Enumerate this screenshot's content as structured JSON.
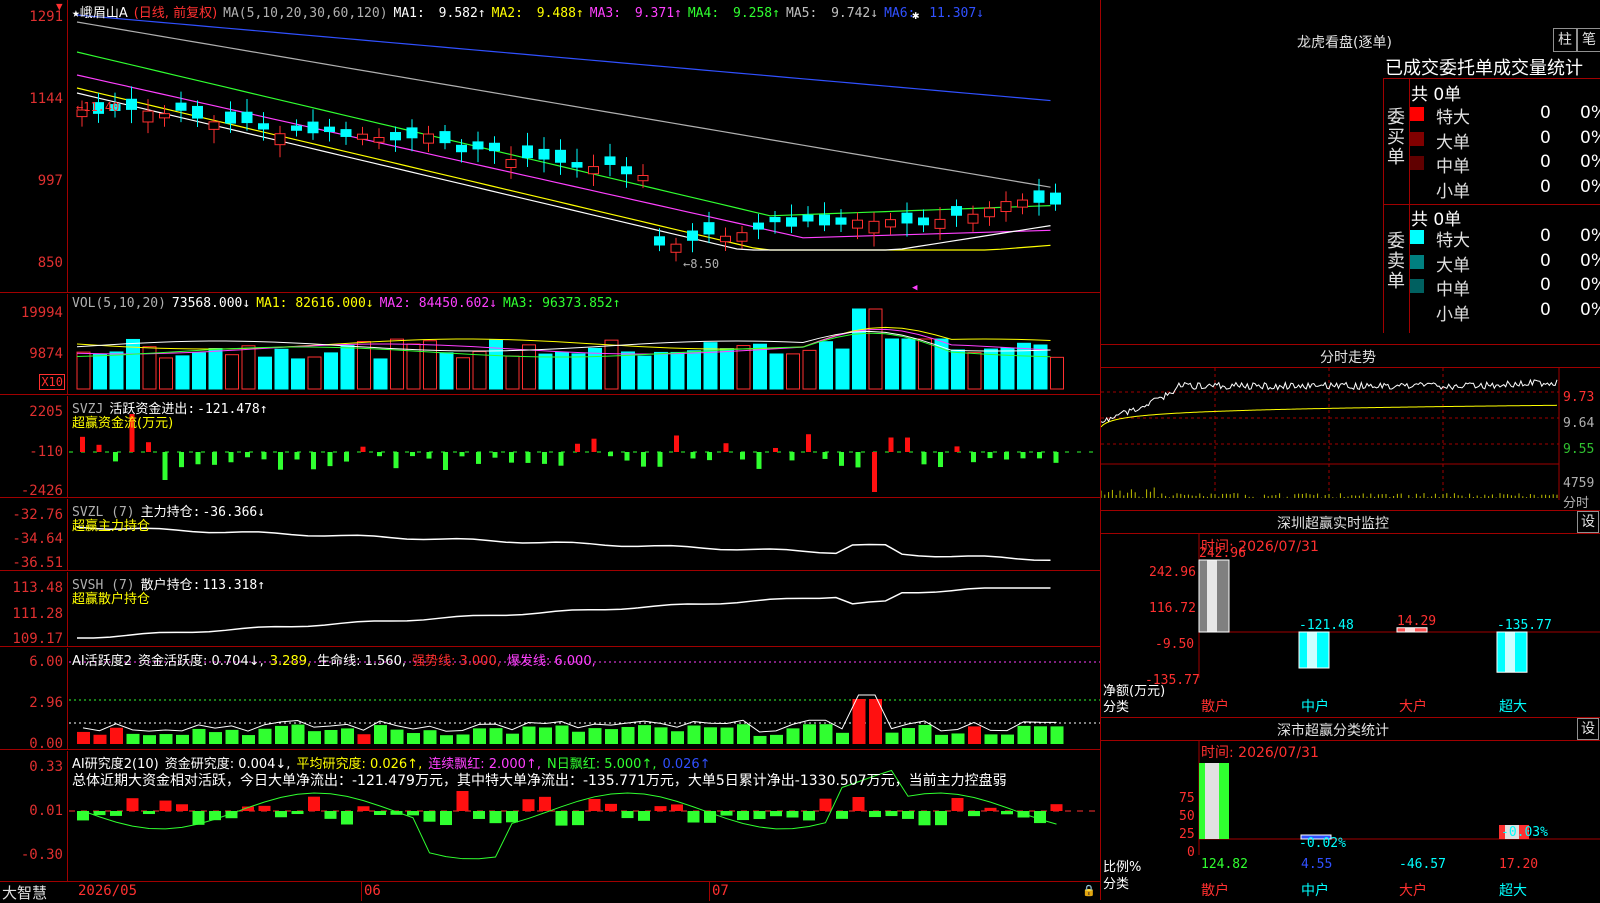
{
  "stock": {
    "name": "峨眉山A",
    "period_label": "(日线, 前复权)"
  },
  "main_chart": {
    "ma_params": "MA(5,10,20,30,60,120)",
    "ma_values": [
      {
        "label": "MA1:",
        "value": "9.582",
        "arrow": "↑",
        "color": "#ffffff"
      },
      {
        "label": "MA2:",
        "value": "9.488",
        "arrow": "↑",
        "color": "#ffff00"
      },
      {
        "label": "MA3:",
        "value": "9.371",
        "arrow": "↑",
        "color": "#ff40ff"
      },
      {
        "label": "MA4:",
        "value": "9.258",
        "arrow": "↑",
        "color": "#30ff30"
      },
      {
        "label": "MA5:",
        "value": "9.742",
        "arrow": "↓",
        "color": "#c0c0c0"
      },
      {
        "label": "MA6:",
        "value": "11.307",
        "arrow": "↓",
        "color": "#3050ff"
      }
    ],
    "y_ticks": [
      "1291",
      "1144",
      "997",
      "850"
    ],
    "high_label": "←11.40",
    "low_label": "←8.50"
  },
  "vol_chart": {
    "title": "VOL(5,10,20)",
    "value": "73568.000↓",
    "ma": [
      {
        "label": "MA1:",
        "value": "82616.000↓",
        "color": "#ffff00"
      },
      {
        "label": "MA2:",
        "value": "84450.602↓",
        "color": "#ff40ff"
      },
      {
        "label": "MA3:",
        "value": "96373.852↑",
        "color": "#30ff30"
      }
    ],
    "y_ticks": [
      "19994",
      "9874"
    ],
    "unit": "X10"
  },
  "svzj": {
    "title": "SVZJ",
    "label": "活跃资金进出:",
    "value": "-121.478↑",
    "subtitle": "超赢资金流(万元)",
    "y_ticks": [
      "2205",
      "-110",
      "-2426"
    ]
  },
  "svzl": {
    "title": "SVZL (7)",
    "label": "主力持仓:",
    "value": "-36.366↓",
    "subtitle": "超赢主力持仓",
    "y_ticks": [
      "-32.76",
      "-34.64",
      "-36.51"
    ]
  },
  "svsh": {
    "title": "SVSH (7)",
    "label": "散户持仓:",
    "value": "113.318↑",
    "subtitle": "超赢散户持仓",
    "y_ticks": [
      "113.48",
      "111.28",
      "109.17"
    ]
  },
  "ai_active": {
    "title": "AI活跃度2",
    "items": [
      {
        "text": "资金活跃度: 0.704↓,",
        "color": "#ffffff"
      },
      {
        "text": "3.289,",
        "color": "#ffff00"
      },
      {
        "text": "生命线: 1.560,",
        "color": "#ffffff"
      },
      {
        "text": "强势线: 3.000,",
        "color": "#ff3030"
      },
      {
        "text": "爆发线: 6.000,",
        "color": "#ff40ff"
      }
    ],
    "y_ticks": [
      "6.00",
      "2.96",
      "0.00"
    ]
  },
  "ai_research": {
    "title": "AI研究度2(10)",
    "items": [
      {
        "text": "资金研究度: 0.004↓,",
        "color": "#ffffff"
      },
      {
        "text": "平均研究度: 0.026↑,",
        "color": "#ffff00"
      },
      {
        "text": "连续飘红: 2.000↑,",
        "color": "#ff40ff"
      },
      {
        "text": "N日飘红: 5.000↑,",
        "color": "#30ff30"
      },
      {
        "text": "0.026↑",
        "color": "#3050ff"
      }
    ],
    "summary": "总体近期大资金相对活跃，今日大单净流出：-121.479万元，其中特大单净流出：-135.771万元，大单5日累计净出-1330.507万元，当前主力控盘弱",
    "y_ticks": [
      "0.33",
      "0.01",
      "-0.30"
    ]
  },
  "bottom_axis": {
    "brand": "大智慧",
    "labels": [
      "2026/05",
      "06",
      "07"
    ]
  },
  "dragon_tiger": {
    "title": "龙虎看盘(逐单)",
    "btn_bar": "柱",
    "btn_note": "笔",
    "tabs": "已成交委托单成交量统计",
    "buy": {
      "side_label": "委买单",
      "total": "共 0单",
      "rows": [
        {
          "label": "特大",
          "count": "0",
          "pct": "0%",
          "color": "#ff0000"
        },
        {
          "label": "大单",
          "count": "0",
          "pct": "0%",
          "color": "#800000"
        },
        {
          "label": "中单",
          "count": "0",
          "pct": "0%",
          "color": "#600000"
        },
        {
          "label": "小单",
          "count": "0",
          "pct": "0%",
          "color": "#000000"
        }
      ]
    },
    "sell": {
      "side_label": "委卖单",
      "total": "共 0单",
      "rows": [
        {
          "label": "特大",
          "count": "0",
          "pct": "0%",
          "color": "#00ffff"
        },
        {
          "label": "大单",
          "count": "0",
          "pct": "0%",
          "color": "#008080"
        },
        {
          "label": "中单",
          "count": "0",
          "pct": "0%",
          "color": "#006060"
        },
        {
          "label": "小单",
          "count": "0",
          "pct": "0%",
          "color": "#000000"
        }
      ]
    }
  },
  "intraday": {
    "title": "分时走势",
    "y_ticks": [
      "9.73",
      "9.64",
      "9.55"
    ],
    "vol_tick": "4759",
    "vol_label": "分时"
  },
  "sz_monitor": {
    "title": "深圳超赢实时监控",
    "btn": "设",
    "time": "时间: 2026/07/31",
    "y_ticks": [
      "242.96",
      "116.72",
      "-9.50",
      "-135.77"
    ],
    "axis_label_1": "净额(万元)",
    "axis_label_2": "分类",
    "categories": [
      "散户",
      "中户",
      "大户",
      "超大"
    ],
    "chart_data": {
      "type": "bar",
      "categories": [
        "散户",
        "中户",
        "大户",
        "超大"
      ],
      "values": [
        242.96,
        -121.48,
        14.29,
        -135.77
      ],
      "ylim": [
        -135.77,
        242.96
      ]
    }
  },
  "sz_class": {
    "title": "深市超赢分类统计",
    "btn": "设",
    "time": "时间: 2026/07/31",
    "y_ticks": [
      "75",
      "50",
      "25",
      "0"
    ],
    "axis_label_1": "比例%",
    "axis_label_2": "分类",
    "categories": [
      "散户",
      "中户",
      "大户",
      "超大"
    ],
    "bar_pct_labels": [
      "-0.02%",
      "-0.03%"
    ],
    "values_text": [
      "124.82",
      "4.55",
      "-46.57",
      "17.20"
    ]
  }
}
